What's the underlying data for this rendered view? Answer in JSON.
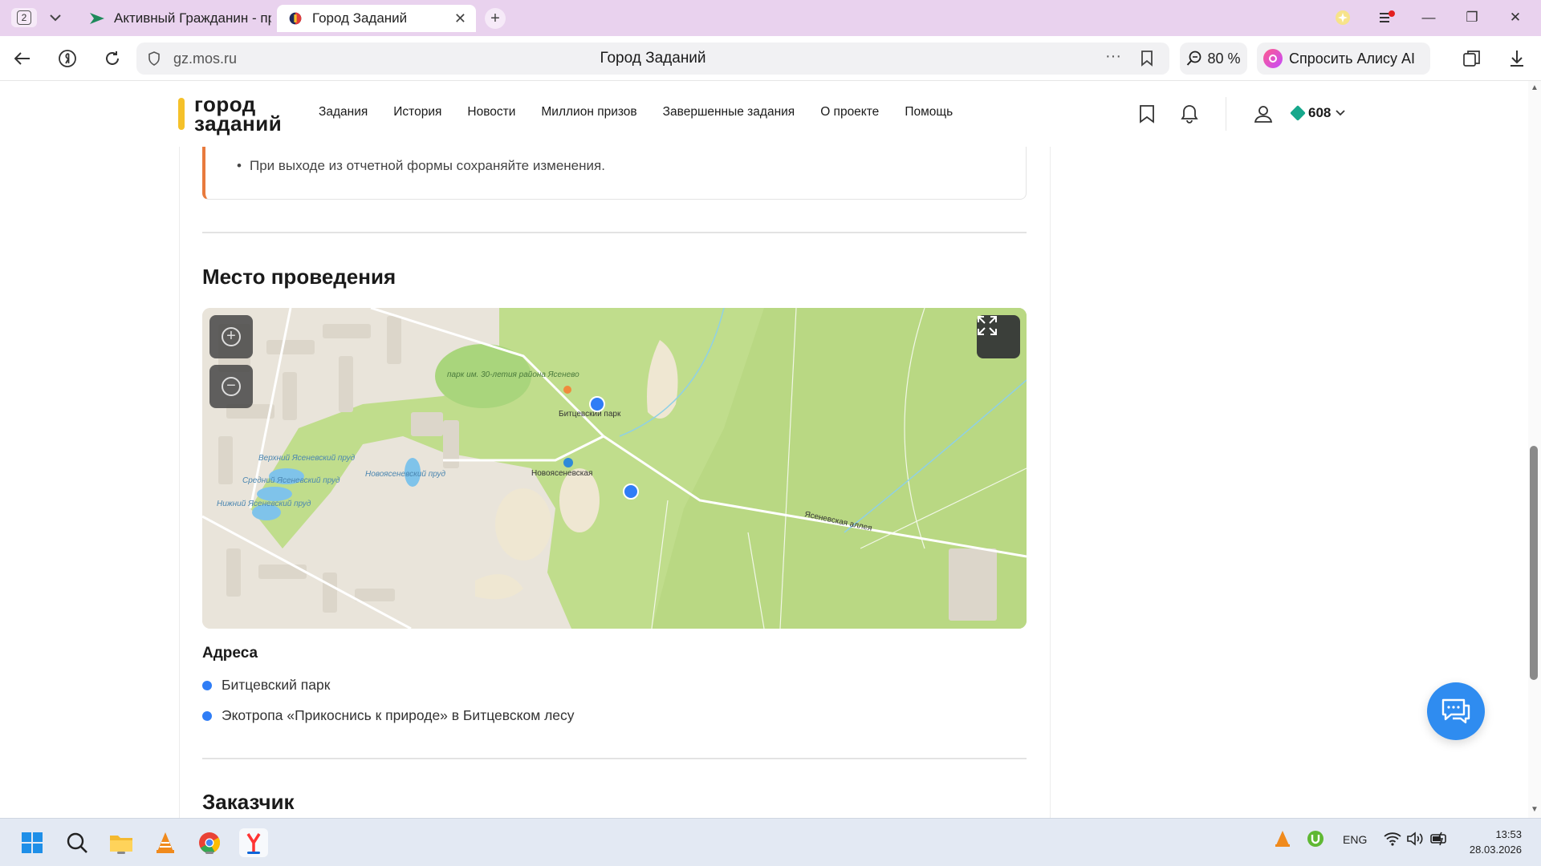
{
  "browser": {
    "tab_count": "2",
    "tabs": [
      {
        "title": "Активный Гражданин - пр",
        "active": false
      },
      {
        "title": "Город Заданий",
        "active": true
      }
    ],
    "url": "gz.mos.ru",
    "page_title": "Город Заданий",
    "zoom": "80 %",
    "alice_label": "Спросить Алису AI"
  },
  "site": {
    "logo_line1": "город",
    "logo_line2": "заданий",
    "menu": [
      "Задания",
      "История",
      "Новости",
      "Миллион призов",
      "Завершенные задания",
      "О проекте",
      "Помощь"
    ],
    "points": "608"
  },
  "content": {
    "notice_text": "При выходе из отчетной формы сохраняйте изменения.",
    "venue_heading": "Место проведения",
    "map_labels": {
      "park": "парк им. 30-летия района Ясенево",
      "metro_bitsa": "Битцевский парк",
      "metro_novo": "Новоясеневская",
      "pond_upper": "Верхний Ясеневский пруд",
      "pond_middle": "Средний Ясеневский пруд",
      "pond_lower": "Нижний Ясеневский пруд",
      "pond_novo": "Новоясеневский пруд",
      "alley": "Ясеневская аллея"
    },
    "addresses_title": "Адреса",
    "addresses": [
      "Битцевский парк",
      "Экотропа «Прикоснись к природе» в Битцевском лесу"
    ],
    "customer_heading": "Заказчик"
  },
  "taskbar": {
    "lang": "ENG",
    "time": "13:53",
    "date": "28.03.2026"
  },
  "colors": {
    "accent_blue": "#2f7df6",
    "logo_yellow": "#f5c12a",
    "notice_orange": "#e87a3d",
    "forest_green": "#c0dd8c"
  }
}
